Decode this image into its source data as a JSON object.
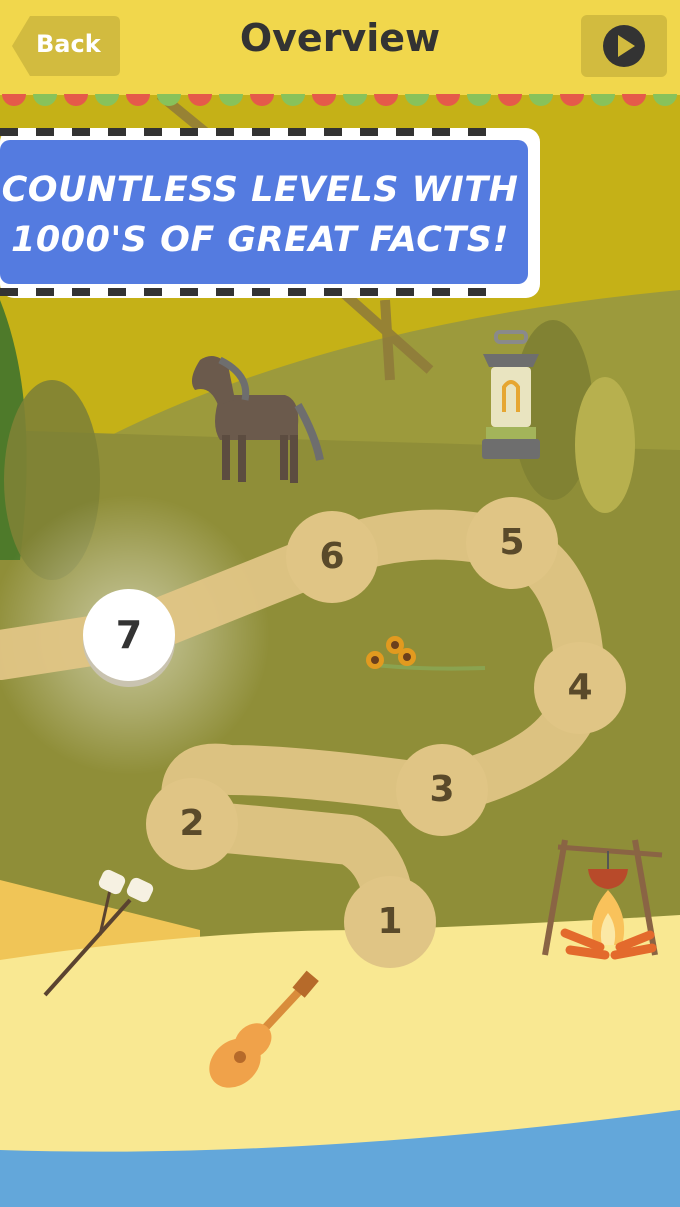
{
  "header": {
    "back_label": "Back",
    "title": "Overview",
    "play_button": "play-icon"
  },
  "banner": {
    "line1": "COUNTLESS LEVELS WITH",
    "line2": "1000'S OF GREAT FACTS!"
  },
  "levels": {
    "l1": "1",
    "l2": "2",
    "l3": "3",
    "l4": "4",
    "l5": "5",
    "l6": "6",
    "l7": "7",
    "current": "7"
  },
  "colors": {
    "header_bg": "#f1d74c",
    "banner_bg": "#547be0",
    "path": "#e0c585",
    "sand": "#f8e58f",
    "water": "#6aa8da"
  }
}
